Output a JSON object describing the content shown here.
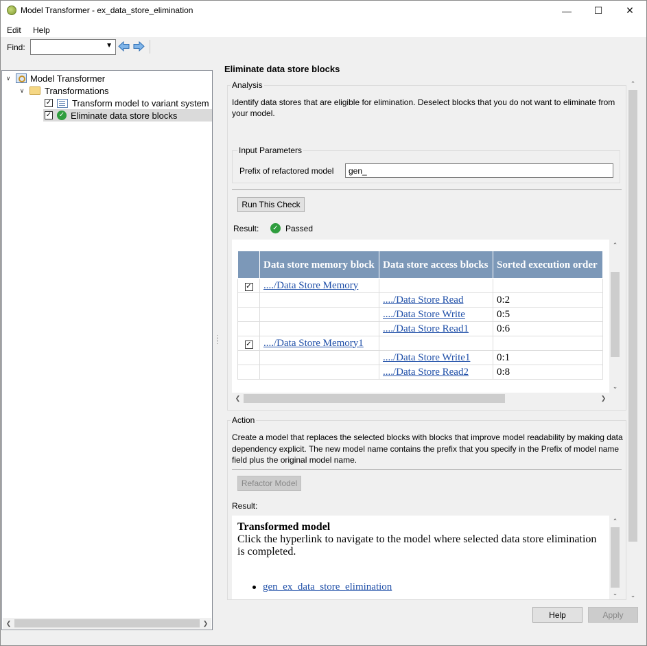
{
  "window": {
    "title": "Model Transformer - ex_data_store_elimination",
    "minimize": "—",
    "maximize": "☐",
    "close": "✕"
  },
  "menu": {
    "edit": "Edit",
    "help": "Help"
  },
  "toolbar": {
    "find_label": "Find:",
    "find_value": ""
  },
  "tree": {
    "root": "Model Transformer",
    "group": "Transformations",
    "items": [
      {
        "label": "Transform model to variant system",
        "checked": true,
        "icon": "list-icon"
      },
      {
        "label": "Eliminate data store blocks",
        "checked": true,
        "icon": "passed-icon",
        "selected": true
      }
    ]
  },
  "page": {
    "heading": "Eliminate data store blocks",
    "analysis": {
      "group_title": "Analysis",
      "description": "Identify data stores that are eligible for elimination. Deselect blocks that you do not want to eliminate from your model.",
      "input_params_title": "Input Parameters",
      "prefix_label": "Prefix of refactored model",
      "prefix_value": "gen_",
      "run_button": "Run This Check",
      "result_label": "Result:",
      "result_status": "Passed",
      "table": {
        "headers": [
          "Data store memory block",
          "Data store access blocks",
          "Sorted execution order"
        ],
        "rows": [
          {
            "checked": true,
            "memory": "..../Data Store Memory",
            "access": "",
            "order": ""
          },
          {
            "checked": null,
            "memory": "",
            "access": "..../Data Store Read",
            "order": "0:2"
          },
          {
            "checked": null,
            "memory": "",
            "access": "..../Data Store Write",
            "order": "0:5"
          },
          {
            "checked": null,
            "memory": "",
            "access": "..../Data Store Read1",
            "order": "0:6"
          },
          {
            "checked": true,
            "memory": "..../Data Store Memory1",
            "access": "",
            "order": ""
          },
          {
            "checked": null,
            "memory": "",
            "access": "..../Data Store Write1",
            "order": "0:1"
          },
          {
            "checked": null,
            "memory": "",
            "access": "..../Data Store Read2",
            "order": "0:8"
          }
        ]
      }
    },
    "action": {
      "group_title": "Action",
      "description": "Create a model that replaces the selected blocks with blocks that improve model readability by making data dependency explicit. The new model name contains the prefix that you specify in the Prefix of model name field plus the original model name.",
      "refactor_button": "Refactor Model",
      "result_label": "Result:",
      "result_title": "Transformed model",
      "result_text": "Click the hyperlink to navigate to the model where selected data store elimination is completed.",
      "result_link": "gen_ex_data_store_elimination"
    }
  },
  "footer": {
    "help_button": "Help",
    "apply_button": "Apply"
  },
  "colors": {
    "table_header": "#7c98b8",
    "link": "#1f4fa8",
    "passed": "#2f9d3e"
  }
}
